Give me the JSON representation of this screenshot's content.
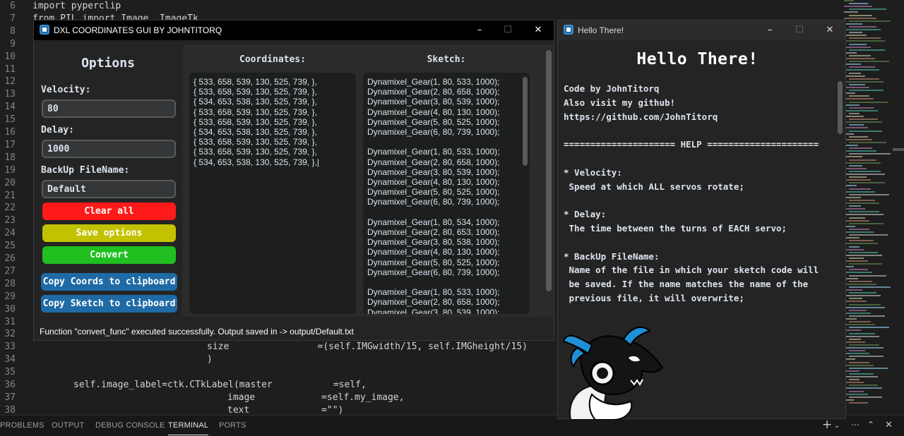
{
  "editor": {
    "lines": [
      {
        "no": "6",
        "code": "import pyperclip"
      },
      {
        "no": "7",
        "code": "from PIL import Image, ImageTk"
      },
      {
        "no": "8",
        "code": ""
      },
      {
        "no": "9",
        "code": ""
      },
      {
        "no": "10",
        "code": ""
      },
      {
        "no": "11",
        "code": ""
      },
      {
        "no": "12",
        "code": ""
      },
      {
        "no": "13",
        "code": ""
      },
      {
        "no": "14",
        "code": ""
      },
      {
        "no": "15",
        "code": ""
      },
      {
        "no": "16",
        "code": ""
      },
      {
        "no": "17",
        "code": ""
      },
      {
        "no": "18",
        "code": ""
      },
      {
        "no": "19",
        "code": ""
      },
      {
        "no": "20",
        "code": ""
      },
      {
        "no": "21",
        "code": ""
      },
      {
        "no": "22",
        "code": ""
      },
      {
        "no": "23",
        "code": ""
      },
      {
        "no": "24",
        "code": ""
      },
      {
        "no": "25",
        "code": ""
      },
      {
        "no": "26",
        "code": ""
      },
      {
        "no": "27",
        "code": ""
      },
      {
        "no": "28",
        "code": ""
      },
      {
        "no": "29",
        "code": ""
      },
      {
        "no": "30",
        "code": ""
      },
      {
        "no": "31",
        "code": ""
      },
      {
        "no": "32",
        "code": ""
      },
      {
        "no": "33",
        "code": "size                =(self.IMGwidth/15, self.IMGheight/15)"
      },
      {
        "no": "34",
        "code": ")"
      },
      {
        "no": "35",
        "code": ""
      },
      {
        "no": "36",
        "code": "self.image_label=ctk.CTkLabel(master           =self,"
      },
      {
        "no": "37",
        "code": "image            =self.my_image,"
      },
      {
        "no": "38",
        "code": "text             =\"\")"
      }
    ]
  },
  "panel": {
    "tabs": [
      "PROBLEMS",
      "OUTPUT",
      "DEBUG CONSOLE",
      "TERMINAL",
      "PORTS"
    ],
    "active_tab": "TERMINAL"
  },
  "dxl_window": {
    "title": "DXL COORDINATES GUI BY JOHNTITORQ",
    "options_title": "Options",
    "velocity_label": "Velocity:",
    "velocity_value": "80",
    "delay_label": "Delay:",
    "delay_value": "1000",
    "backup_label": "BackUp FileName:",
    "backup_value": "Default",
    "clear_button": "Clear all",
    "save_button": "Save options",
    "convert_button": "Convert",
    "copy_coords_button": "Copy Coords to clipboard",
    "copy_sketch_button": "Copy Sketch to clipboard",
    "coords_title": "Coordinates:",
    "sketch_title": "Sketch:",
    "coords_text": "{ 533, 658, 539, 130, 525, 739, },\n{ 533, 658, 539, 130, 525, 739, },\n{ 534, 653, 538, 130, 525, 739, },\n{ 533, 658, 539, 130, 525, 739, },\n{ 533, 658, 539, 130, 525, 739, },\n{ 534, 653, 538, 130, 525, 739, },\n{ 533, 658, 539, 130, 525, 739, },\n{ 533, 658, 539, 130, 525, 739, },\n{ 534, 653, 538, 130, 525, 739, },|",
    "sketch_text": "Dynamixel_Gear(1, 80, 533, 1000);\nDynamixel_Gear(2, 80, 658, 1000);\nDynamixel_Gear(3, 80, 539, 1000);\nDynamixel_Gear(4, 80, 130, 1000);\nDynamixel_Gear(5, 80, 525, 1000);\nDynamixel_Gear(6, 80, 739, 1000);\n\nDynamixel_Gear(1, 80, 533, 1000);\nDynamixel_Gear(2, 80, 658, 1000);\nDynamixel_Gear(3, 80, 539, 1000);\nDynamixel_Gear(4, 80, 130, 1000);\nDynamixel_Gear(5, 80, 525, 1000);\nDynamixel_Gear(6, 80, 739, 1000);\n\nDynamixel_Gear(1, 80, 534, 1000);\nDynamixel_Gear(2, 80, 653, 1000);\nDynamixel_Gear(3, 80, 538, 1000);\nDynamixel_Gear(4, 80, 130, 1000);\nDynamixel_Gear(5, 80, 525, 1000);\nDynamixel_Gear(6, 80, 739, 1000);\n\nDynamixel_Gear(1, 80, 533, 1000);\nDynamixel_Gear(2, 80, 658, 1000);\nDynamixel_Gear(3, 80, 539, 1000);",
    "status": "Function \"convert_func\" executed successfully. Output saved in -> output/Default.txt",
    "colors": {
      "clear": "#ff1a1a",
      "save": "#c2c200",
      "convert": "#1fc01f",
      "copy": "#1f6aa5"
    }
  },
  "hello_window": {
    "title": "Hello There!",
    "heading": "Hello There!",
    "body": "Code by JohnTitorq\nAlso visit my github!\nhttps://github.com/JohnTitorq\n\n===================== HELP =====================\n\n* Velocity:\n Speed at which ALL servos rotate;\n\n* Delay:\n The time between the turns of EACH servo;\n\n* BackUp FileName:\n Name of the file in which your sketch code will\n be saved. If the name matches the name of the\n previous file, it will overwrite;",
    "mascot_icon": "dragon-mascot"
  }
}
